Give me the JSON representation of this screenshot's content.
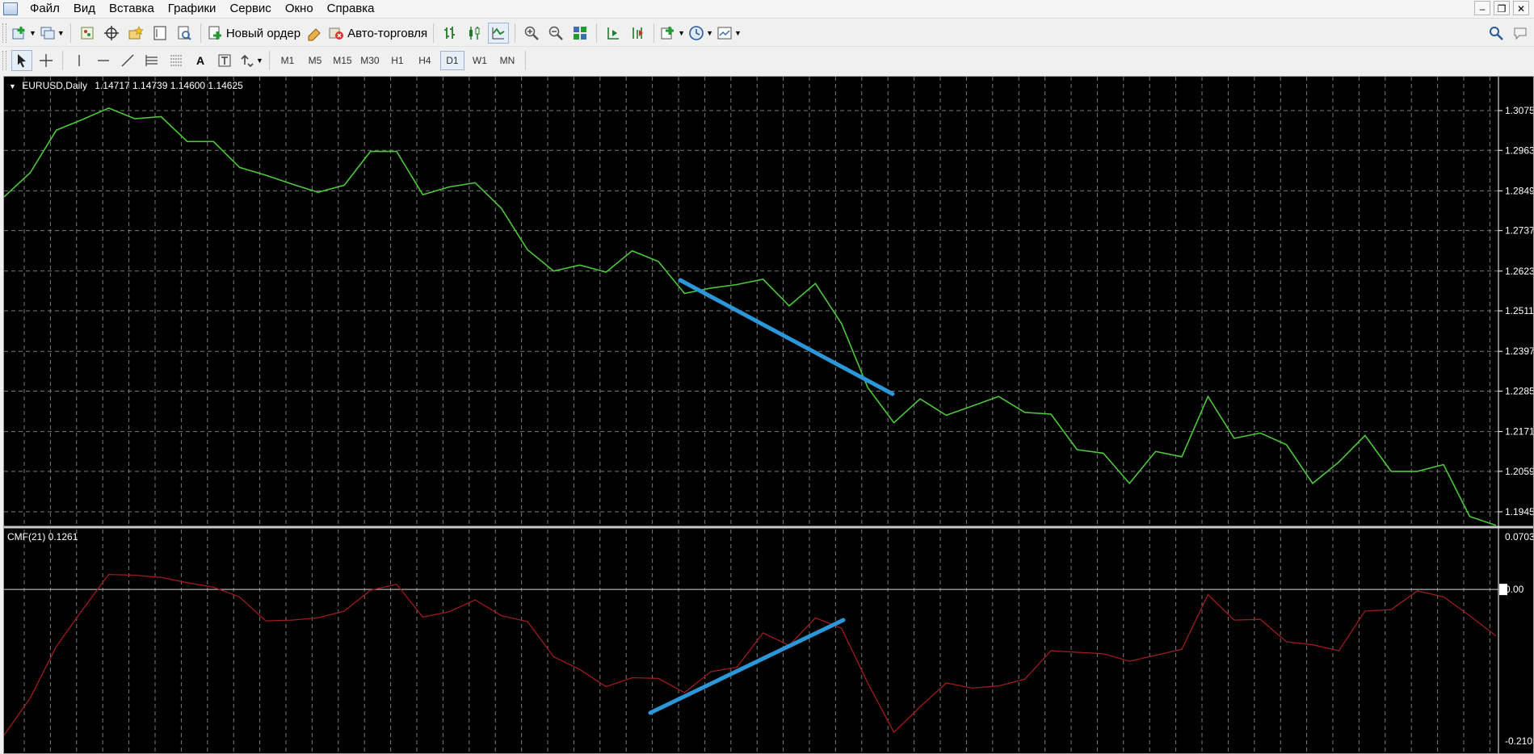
{
  "menu": {
    "items": [
      "Файл",
      "Вид",
      "Вставка",
      "Графики",
      "Сервис",
      "Окно",
      "Справка"
    ]
  },
  "toolbar": {
    "new_order_label": "Новый ордер",
    "autotrade_label": "Авто-торговля"
  },
  "drawing_toolbar": {
    "text_tool_label": "A"
  },
  "timeframes": [
    "M1",
    "M5",
    "M15",
    "M30",
    "H1",
    "H4",
    "D1",
    "W1",
    "MN"
  ],
  "active_timeframe": "D1",
  "main_chart": {
    "symbol_info": "EURUSD,Daily",
    "ohlc": "1.14717 1.14739 1.14600 1.14625",
    "price_labels": [
      "1.3075",
      "1.2963",
      "1.2849",
      "1.2737",
      "1.2623",
      "1.2511",
      "1.2397",
      "1.2285",
      "1.2171",
      "1.2059",
      "1.1945"
    ],
    "line_color": "#4cc73a",
    "values": [
      1.2832,
      1.29,
      1.302,
      1.305,
      1.3082,
      1.3052,
      1.3058,
      1.2988,
      1.2988,
      1.2915,
      1.2893,
      1.2868,
      1.2845,
      1.2865,
      1.296,
      1.296,
      1.2838,
      1.286,
      1.2872,
      1.28,
      1.2683,
      1.2623,
      1.264,
      1.262,
      1.268,
      1.265,
      1.256,
      1.2575,
      1.2585,
      1.26,
      1.2525,
      1.2588,
      1.2475,
      1.2295,
      1.2196,
      1.2263,
      1.2217,
      1.2243,
      1.227,
      1.2225,
      1.222,
      1.212,
      1.211,
      1.2025,
      1.2115,
      1.21,
      1.227,
      1.2152,
      1.2167,
      1.2134,
      1.2025,
      1.2085,
      1.216,
      1.2059,
      1.2059,
      1.2078,
      1.1932,
      1.1907
    ]
  },
  "indicator": {
    "label": "CMF(21) 0.1261",
    "axis_labels": [
      "0.0703",
      "0.00",
      "-0.2103"
    ],
    "line_color": "#9c1c1c",
    "values": [
      -0.195,
      -0.145,
      -0.076,
      -0.027,
      0.02,
      0.019,
      0.016,
      0.009,
      0.003,
      -0.01,
      -0.042,
      -0.041,
      -0.038,
      -0.029,
      -0.001,
      0.007,
      -0.037,
      -0.03,
      -0.014,
      -0.035,
      -0.043,
      -0.09,
      -0.107,
      -0.13,
      -0.118,
      -0.119,
      -0.138,
      -0.11,
      -0.104,
      -0.058,
      -0.075,
      -0.038,
      -0.052,
      -0.125,
      -0.191,
      -0.157,
      -0.125,
      -0.132,
      -0.129,
      -0.12,
      -0.082,
      -0.084,
      -0.086,
      -0.096,
      -0.088,
      -0.08,
      -0.007,
      -0.041,
      -0.04,
      -0.07,
      -0.074,
      -0.082,
      -0.029,
      -0.027,
      -0.002,
      -0.01,
      -0.035,
      -0.062
    ]
  },
  "annotations": {
    "trendline_color": "#2b97d8"
  }
}
